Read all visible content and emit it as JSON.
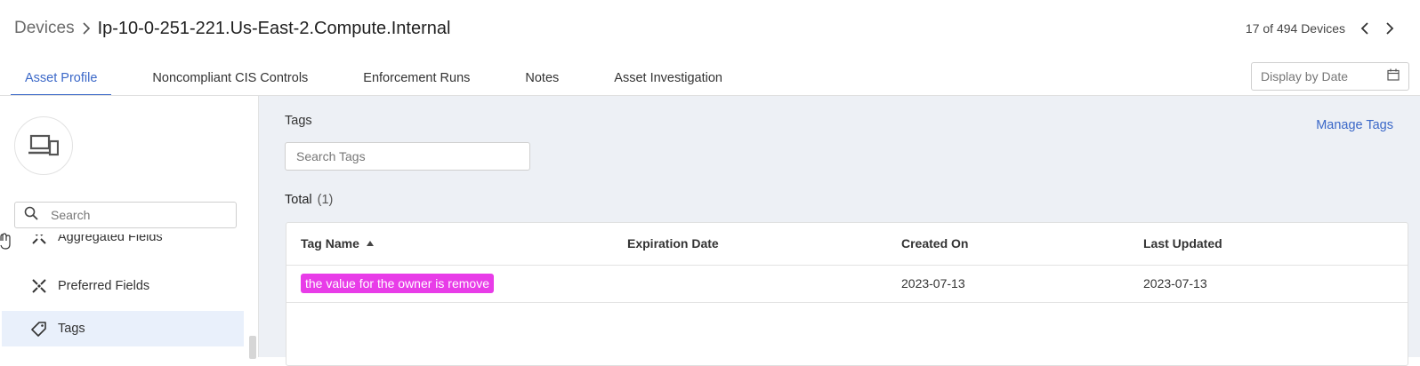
{
  "breadcrumb": {
    "root": "Devices",
    "current": "Ip-10-0-251-221.Us-East-2.Compute.Internal"
  },
  "pager": {
    "text": "17 of 494 Devices"
  },
  "tabs": [
    {
      "label": "Asset Profile",
      "active": true
    },
    {
      "label": "Noncompliant CIS Controls"
    },
    {
      "label": "Enforcement Runs"
    },
    {
      "label": "Notes"
    },
    {
      "label": "Asset Investigation"
    }
  ],
  "date_picker": {
    "placeholder": "Display by Date"
  },
  "sidebar": {
    "search_placeholder": "Search",
    "items": [
      {
        "label": "Aggregated Fields",
        "icon": "fields-icon"
      },
      {
        "label": "Preferred Fields",
        "icon": "fields-icon"
      },
      {
        "label": "Tags",
        "icon": "tag-icon",
        "active": true
      }
    ]
  },
  "main": {
    "title": "Tags",
    "manage_label": "Manage Tags",
    "search_placeholder": "Search Tags",
    "total_label": "Total",
    "total_count": "(1)",
    "table": {
      "headers": [
        "Tag Name",
        "Expiration Date",
        "Created On",
        "Last Updated"
      ],
      "rows": [
        {
          "tag": "the value for the owner is remove",
          "expiration": "",
          "created": "2023-07-13",
          "updated": "2023-07-13"
        }
      ]
    }
  },
  "colors": {
    "accent": "#3b68c8",
    "tag_chip": "#e83ce8",
    "main_bg": "#edf0f5",
    "active_item_bg": "#e9f0fb"
  }
}
